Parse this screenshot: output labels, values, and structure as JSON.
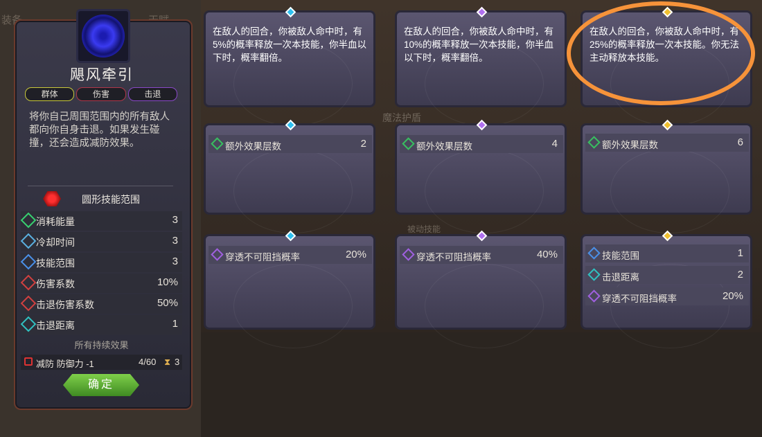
{
  "background": {
    "left_top_words": [
      "装备",
      "天赋"
    ],
    "mid_words": [
      "魔法护盾",
      "被动技能"
    ]
  },
  "skill": {
    "name": "飓风牵引",
    "tags": [
      "群体",
      "伤害",
      "击退"
    ],
    "description": "将你自己周围范围内的所有敌人都向你自身击退。如果发生碰撞，还会造成减防效果。",
    "range_type": "圆形技能范围",
    "stats": [
      {
        "label": "消耗能量",
        "value": "3",
        "icon": "diamond-energy-icon",
        "color": "#38d070"
      },
      {
        "label": "冷却时间",
        "value": "3",
        "icon": "cooldown-icon",
        "color": "#5ab0e0"
      },
      {
        "label": "技能范围",
        "value": "3",
        "icon": "range-icon",
        "color": "#4a90e8"
      },
      {
        "label": "伤害系数",
        "value": "10%",
        "icon": "damage-icon",
        "color": "#d04040"
      },
      {
        "label": "击退伤害系数",
        "value": "50%",
        "icon": "knockback-damage-icon",
        "color": "#d04040"
      },
      {
        "label": "击退距离",
        "value": "1",
        "icon": "knockback-distance-icon",
        "color": "#30c0c0"
      }
    ],
    "effects_title": "所有持续效果",
    "effect": {
      "label": "减防 防御力 -1",
      "count": "4/60",
      "turns": "3"
    },
    "confirm_label": "确定"
  },
  "cards": {
    "upper": [
      {
        "text": "在敌人的回合，你被敌人命中时，有5%的概率释放一次本技能，你半血以下时，概率翻倍。",
        "gem": "blue"
      },
      {
        "text": "在敌人的回合，你被敌人命中时，有10%的概率释放一次本技能，你半血以下时，概率翻倍。",
        "gem": "purple"
      },
      {
        "text": "在敌人的回合，你被敌人命中时，有25%的概率释放一次本技能。你无法主动释放本技能。",
        "gem": "gold"
      }
    ],
    "mid": [
      {
        "label": "额外效果层数",
        "value": "2",
        "gem": "blue"
      },
      {
        "label": "额外效果层数",
        "value": "4",
        "gem": "purple"
      },
      {
        "label": "额外效果层数",
        "value": "6",
        "gem": "gold"
      }
    ],
    "low": [
      {
        "gem": "blue",
        "rows": [
          {
            "label": "穿透不可阻挡概率",
            "value": "20%",
            "color": "#a060e0"
          }
        ]
      },
      {
        "gem": "purple",
        "rows": [
          {
            "label": "穿透不可阻挡概率",
            "value": "40%",
            "color": "#a060e0"
          }
        ]
      },
      {
        "gem": "gold",
        "rows": [
          {
            "label": "技能范围",
            "value": "1",
            "color": "#4a90e8"
          },
          {
            "label": "击退距离",
            "value": "2",
            "color": "#30c0c0"
          },
          {
            "label": "穿透不可阻挡概率",
            "value": "20%",
            "color": "#a060e0"
          }
        ]
      }
    ]
  }
}
